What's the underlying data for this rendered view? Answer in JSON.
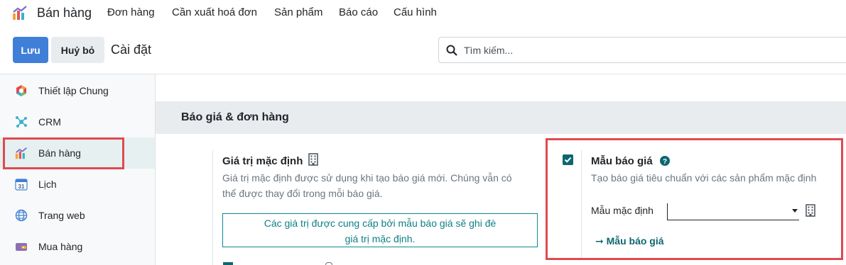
{
  "app": {
    "name": "Bán hàng",
    "icon": "sales-chart-icon",
    "menu": [
      "Đơn hàng",
      "Cần xuất hoá đơn",
      "Sản phẩm",
      "Báo cáo",
      "Cấu hình"
    ]
  },
  "control_panel": {
    "save_label": "Lưu",
    "discard_label": "Huỷ bỏ",
    "title": "Cài đặt",
    "search_placeholder": "Tìm kiếm..."
  },
  "sidebar": {
    "items": [
      {
        "label": "Thiết lập Chung",
        "icon": "settings-hexagon-icon"
      },
      {
        "label": "CRM",
        "icon": "crm-network-icon"
      },
      {
        "label": "Bán hàng",
        "icon": "sales-chart-icon",
        "active": true
      },
      {
        "label": "Lịch",
        "icon": "calendar-31-icon"
      },
      {
        "label": "Trang web",
        "icon": "globe-icon"
      },
      {
        "label": "Mua hàng",
        "icon": "purchase-card-icon"
      }
    ]
  },
  "section": {
    "title": "Báo giá & đơn hàng"
  },
  "default_values": {
    "title": "Giá trị mặc định",
    "desc_line1": "Giá trị mặc định được sử dụng khi tạo báo giá mới. Chúng vẫn có",
    "desc_line2": "thể được thay đổi trong mỗi báo giá.",
    "alert_line1": "Các giá trị được cung cấp bởi mẫu báo giá sẽ ghi đè",
    "alert_line2": "giá trị mặc định."
  },
  "quotation_templates": {
    "checked": true,
    "title": "Mẫu báo giá",
    "desc": "Tạo báo giá tiêu chuẩn với các sản phẩm mặc định",
    "field_label": "Mẫu mặc định",
    "field_value": "",
    "link_label": "Mẫu báo giá"
  },
  "colors": {
    "primary": "#3f7fd8",
    "accent": "#0e6670",
    "highlight": "#e0494f"
  }
}
